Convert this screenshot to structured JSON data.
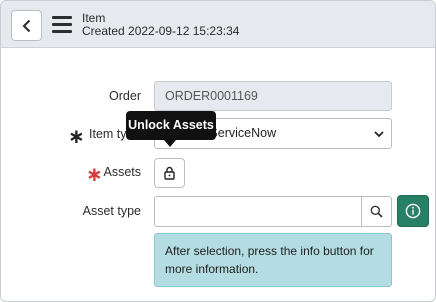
{
  "header": {
    "title": "Item",
    "subtitle": "Created 2022-09-12 15:23:34",
    "back_icon": "chevron-left-icon",
    "menu_icon": "hamburger-menu-icon"
  },
  "form": {
    "order": {
      "label": "Order",
      "value": "ORDER0001169"
    },
    "item_type": {
      "label": "Item ty",
      "value": "n ServiceNow",
      "required": true
    },
    "assets": {
      "label": "Assets",
      "required": true,
      "lock_icon": "unlock-icon",
      "tooltip": "Unlock Assets"
    },
    "asset_type": {
      "label": "Asset type",
      "value": "",
      "search_icon": "search-icon",
      "info_icon": "info-icon"
    },
    "info_message": "After selection, press the info button for more information."
  },
  "colors": {
    "header_bg": "#e6e9ee",
    "required_black": "#222222",
    "required_red": "#d63b3b",
    "info_button": "#288064",
    "info_box_bg": "#b4dde3",
    "tooltip_bg": "#111111"
  }
}
